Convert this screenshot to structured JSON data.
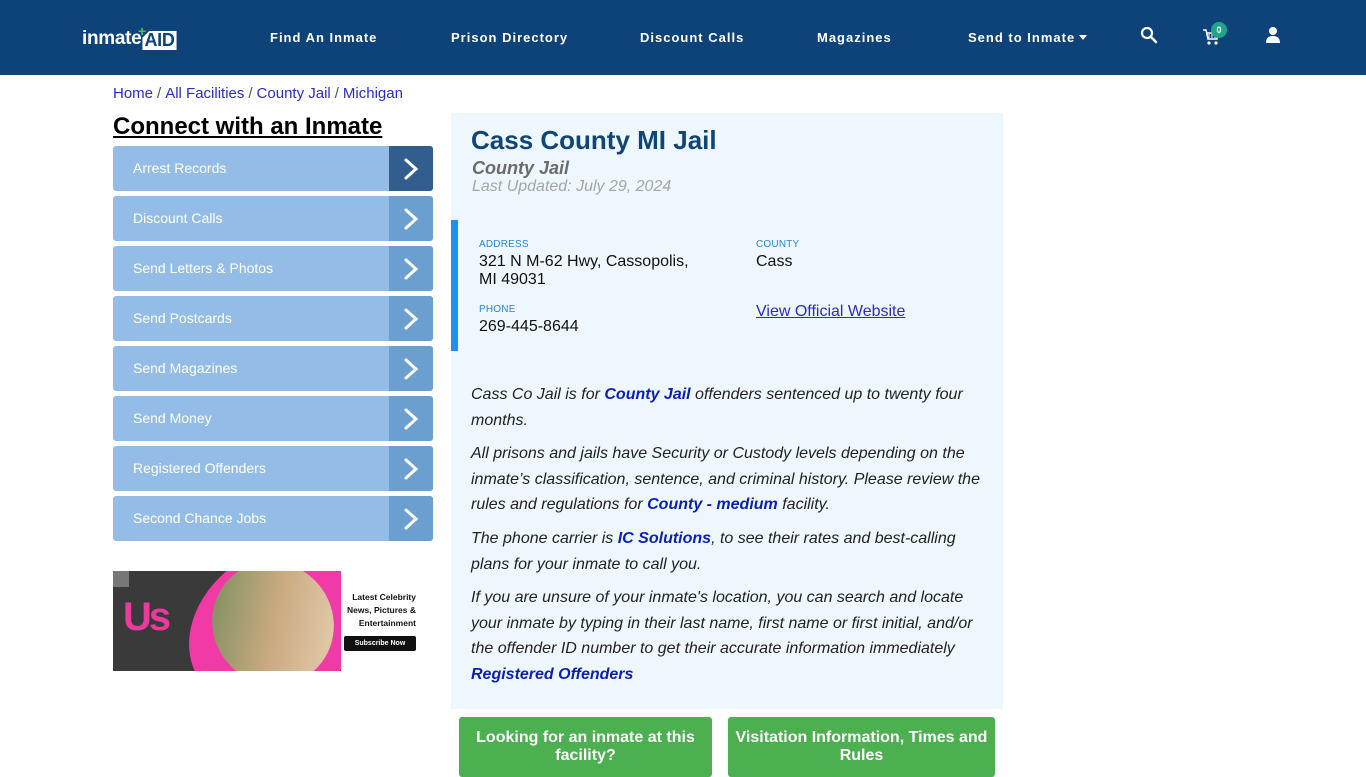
{
  "header": {
    "logo_text": "inmate",
    "logo_accent": "AID",
    "nav": [
      {
        "label": "Find An Inmate"
      },
      {
        "label": "Prison Directory"
      },
      {
        "label": "Discount Calls"
      },
      {
        "label": "Magazines"
      },
      {
        "label": "Send to Inmate",
        "has_dropdown": true
      }
    ],
    "icons": {
      "search": "search-icon",
      "cart": "cart-icon",
      "user": "user-icon"
    },
    "cart_count": "0"
  },
  "breadcrumb": [
    {
      "label": "Home"
    },
    {
      "label": "All Facilities"
    },
    {
      "label": "County Jail"
    },
    {
      "label": "Michigan"
    }
  ],
  "breadcrumb_separator": "/",
  "sidebar": {
    "title": "Connect with an Inmate",
    "items": [
      {
        "label": "Arrest Records"
      },
      {
        "label": "Discount Calls"
      },
      {
        "label": "Send Letters & Photos"
      },
      {
        "label": "Send Postcards"
      },
      {
        "label": "Send Magazines"
      },
      {
        "label": "Send Money"
      },
      {
        "label": "Registered Offenders"
      },
      {
        "label": "Second Chance Jobs"
      }
    ],
    "ad": {
      "brand": "Us",
      "headline": "Latest Celebrity News, Pictures & Entertainment",
      "cta": "Subscribe Now"
    }
  },
  "facility": {
    "name": "Cass County MI Jail",
    "type": "County Jail",
    "last_updated": "Last Updated: July 29, 2024",
    "address_label": "ADDRESS",
    "address_line1": "321 N M-62 Hwy, Cassopolis,",
    "address_line2": "MI 49031",
    "county_label": "COUNTY",
    "county": "Cass",
    "phone_label": "PHONE",
    "phone": "269-445-8644",
    "website_link": "View Official Website"
  },
  "description": {
    "p1_a": "Cass Co Jail is for ",
    "p1_link": "County Jail",
    "p1_b": " offenders sentenced up to twenty four months.",
    "p2_a": "All prisons and jails have Security or Custody levels depending on the inmate’s classification, sentence, and criminal history. Please review the rules and regulations for ",
    "p2_link": "County - medium",
    "p2_b": " facility.",
    "p3_a": "The phone carrier is ",
    "p3_link": "IC Solutions",
    "p3_b": ", to see their rates and best-calling plans for your inmate to call you.",
    "p4_a": "If you are unsure of your inmate's location, you can search and locate your inmate by typing in their last name, first name or first initial, and/or the offender ID number to get their accurate information immediately ",
    "p4_link": "Registered Offenders"
  },
  "actions": {
    "find_inmate": "Looking for an inmate at this facility?",
    "visitation": "Visitation Information, Times and Rules"
  },
  "colors": {
    "header_bg": "#0d4378",
    "menu_bg": "#93bde6",
    "accent_bar": "#1e90f0",
    "button_green": "#4caf50",
    "link_blue": "#0b1fb5"
  }
}
